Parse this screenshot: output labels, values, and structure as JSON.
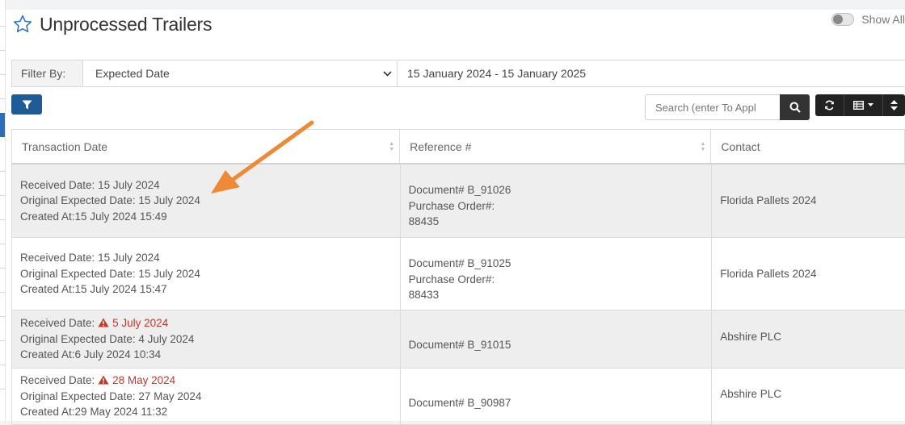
{
  "page": {
    "title": "Unprocessed Trailers",
    "show_all_label": "Show All"
  },
  "filter": {
    "label": "Filter By:",
    "selected": "Expected Date",
    "date_range": "15 January 2024 - 15 January 2025"
  },
  "search": {
    "placeholder": "Search (enter To Appl"
  },
  "columns": {
    "transaction_date": "Transaction Date",
    "reference": "Reference #",
    "contact": "Contact"
  },
  "labels": {
    "received": "Received Date:",
    "original_expected": "Original Expected Date:",
    "created_at": "Created At:",
    "document": "Document#",
    "purchase_order": "Purchase Order#:"
  },
  "rows": [
    {
      "received": "15 July 2024",
      "original_expected": "15 July 2024",
      "created_at": "15 July 2024 15:49",
      "document": "B_91026",
      "purchase_order": "88435",
      "contact": "Florida Pallets 2024"
    },
    {
      "received": "15 July 2024",
      "original_expected": "15 July 2024",
      "created_at": "15 July 2024 15:47",
      "document": "B_91025",
      "purchase_order": "88433",
      "contact": "Florida Pallets 2024"
    },
    {
      "received": "5 July 2024",
      "original_expected": "4 July 2024",
      "created_at": "6 July 2024 10:34",
      "document": "B_91015",
      "contact": "Abshire PLC"
    },
    {
      "received": "28 May 2024",
      "original_expected": "27 May 2024",
      "created_at": "29 May 2024 11:32",
      "document": "B_90987",
      "contact": "Abshire PLC"
    }
  ],
  "colors": {
    "primary": "#1d5c96",
    "warning": "#c0392b",
    "annotation_arrow": "#ee8a35"
  }
}
